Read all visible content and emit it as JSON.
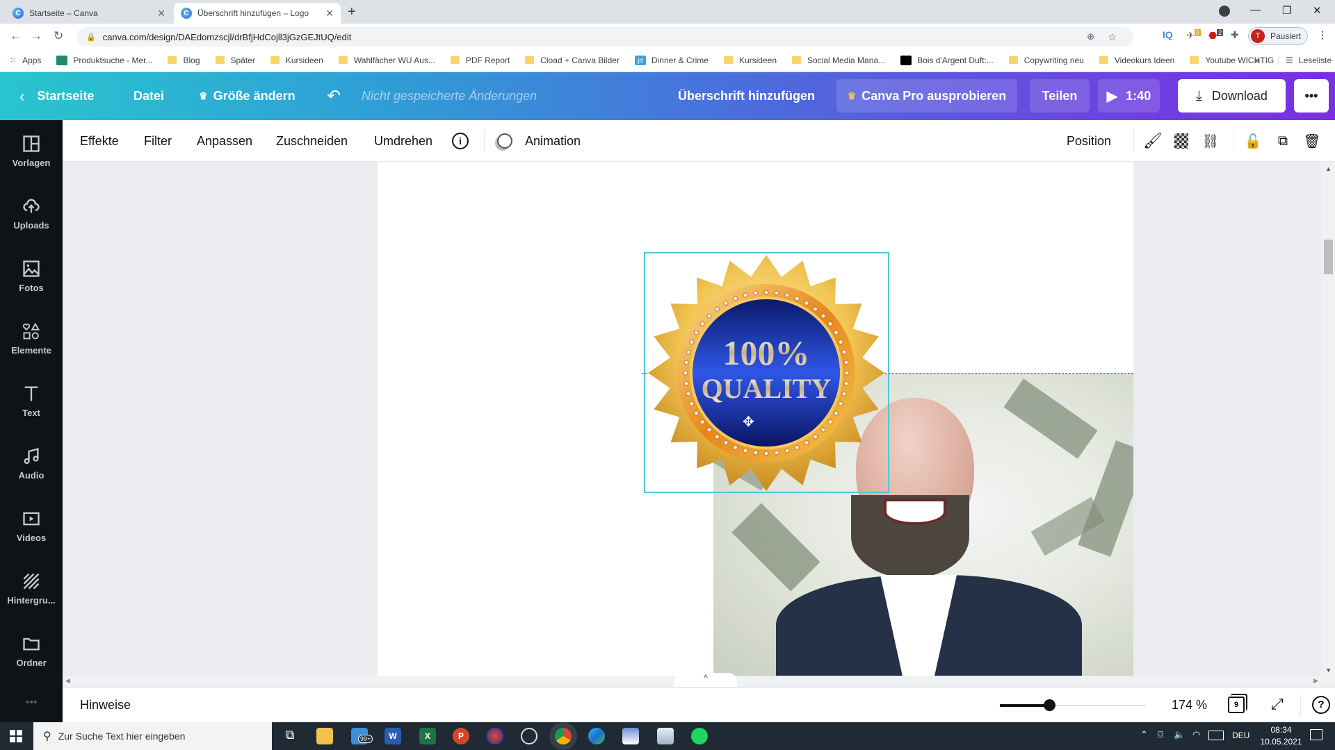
{
  "browser": {
    "tabs": [
      {
        "title": "Startseite – Canva",
        "active": false
      },
      {
        "title": "Überschrift hinzufügen – Logo",
        "active": true
      }
    ],
    "new_tab": "+",
    "url": "canva.com/design/DAEdomzscjl/drBfjHdCojll3jGzGEJtUQ/edit",
    "profile_initial": "T",
    "profile_label": "Pausiert",
    "ext_badges": {
      "ext1": "0",
      "abp": "2"
    },
    "bookmarks": [
      {
        "label": "Apps",
        "icon": "apps-grid"
      },
      {
        "label": "Produktsuche - Mer...",
        "icon": "shirt"
      },
      {
        "label": "Blog",
        "icon": "folder"
      },
      {
        "label": "Später",
        "icon": "folder"
      },
      {
        "label": "Kursideen",
        "icon": "folder"
      },
      {
        "label": "Wahlfächer WU Aus...",
        "icon": "folder"
      },
      {
        "label": "PDF Report",
        "icon": "folder"
      },
      {
        "label": "Cload + Canva Bilder",
        "icon": "folder"
      },
      {
        "label": "Dinner & Crime",
        "icon": "jd"
      },
      {
        "label": "Kursideen",
        "icon": "folder"
      },
      {
        "label": "Social Media Mana...",
        "icon": "folder"
      },
      {
        "label": "Bois d'Argent Duft:...",
        "icon": "dior"
      },
      {
        "label": "Copywriting neu",
        "icon": "folder"
      },
      {
        "label": "Videokurs Ideen",
        "icon": "folder"
      },
      {
        "label": "Youtube WICHTIG",
        "icon": "folder"
      }
    ],
    "bookmarks_more": "»",
    "reading_list": "Leseliste"
  },
  "header": {
    "back_label": "Startseite",
    "file_label": "Datei",
    "resize_label": "Größe ändern",
    "unsaved_label": "Nicht gespeicherte Änderungen",
    "title": "Überschrift hinzufügen",
    "pro_label": "Canva Pro ausprobieren",
    "share_label": "Teilen",
    "play_duration": "1:40",
    "download_label": "Download",
    "more_label": "•••"
  },
  "sidebar": {
    "items": [
      {
        "label": "Vorlagen",
        "icon": "templates"
      },
      {
        "label": "Uploads",
        "icon": "upload-cloud"
      },
      {
        "label": "Fotos",
        "icon": "photo"
      },
      {
        "label": "Elemente",
        "icon": "shapes"
      },
      {
        "label": "Text",
        "icon": "text"
      },
      {
        "label": "Audio",
        "icon": "music"
      },
      {
        "label": "Videos",
        "icon": "video"
      },
      {
        "label": "Hintergru...",
        "icon": "background"
      },
      {
        "label": "Ordner",
        "icon": "folder"
      }
    ],
    "more": "•••"
  },
  "toolbar": {
    "effects": "Effekte",
    "filter": "Filter",
    "adjust": "Anpassen",
    "crop": "Zuschneiden",
    "flip": "Umdrehen",
    "animation": "Animation",
    "position": "Position"
  },
  "canvas": {
    "badge_line1": "100%",
    "badge_line2": "QUALITY"
  },
  "footer": {
    "notes_label": "Hinweise",
    "zoom_percent": "174 %",
    "zoom_slider_fraction": 0.34,
    "page_count": "9"
  },
  "taskbar": {
    "search_placeholder": "Zur Suche Text hier eingeben",
    "mail_badge": "99+",
    "lang": "DEU",
    "time": "08:34",
    "date": "10.05.2021"
  }
}
